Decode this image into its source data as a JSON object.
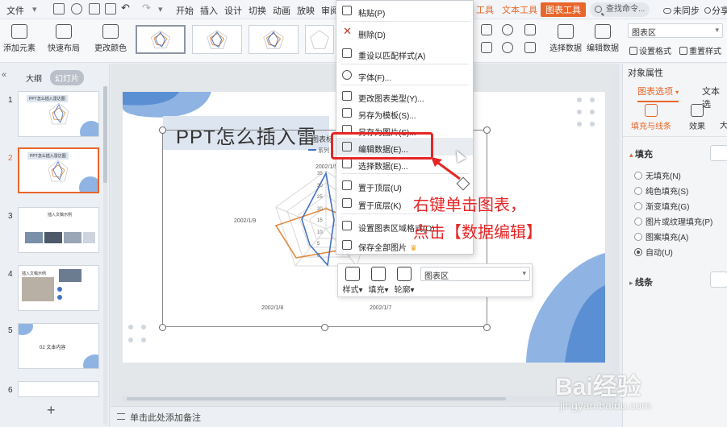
{
  "menubar": {
    "file": "文件",
    "tabs": [
      "开始",
      "插入",
      "设计",
      "切换",
      "动画",
      "放映",
      "审阅"
    ],
    "ctx_tabs": [
      "工具",
      "文本工具",
      "图表工具"
    ],
    "search": "查找命令...",
    "sync": "未同步",
    "share": "分享"
  },
  "ribbon": {
    "add_element": "添加元素",
    "quick_layout": "快速布局",
    "change_color": "更改颜色",
    "select_data": "选择数据",
    "edit_data": "编辑数据",
    "chart_area": "图表区",
    "set_format": "设置格式",
    "reset_style": "重置样式"
  },
  "left_panel": {
    "tab_outline": "大纲",
    "tab_slides": "幻灯片",
    "slides": [
      "1",
      "2",
      "3",
      "4",
      "5",
      "6"
    ],
    "slide1_title": "PPT怎么插入雷达图",
    "slide3_title": "插入文稿示例",
    "slide4_title": "插入文稿示例",
    "slide5_text": "02 文本内容"
  },
  "slide": {
    "title": "PPT怎么插入雷",
    "chart_title": "图表标",
    "legend": "系列 1",
    "axis_labels": [
      "2002/1/5",
      "2002/1/9",
      "2002/1/8",
      "2002/1/7"
    ],
    "ticks": [
      "35",
      "30",
      "25",
      "20",
      "15",
      "10",
      "5",
      "0"
    ]
  },
  "notes": "单击此处添加备注",
  "context_menu": {
    "items": [
      {
        "label": "粘贴(P)",
        "icon": "paste-icon"
      },
      {
        "label": "删除(D)",
        "icon": "delete-icon"
      },
      {
        "label": "重设以匹配样式(A)",
        "icon": "reset-style-icon"
      },
      {
        "label": "字体(F)...",
        "icon": "font-icon"
      },
      {
        "label": "更改图表类型(Y)...",
        "icon": "chart-type-icon"
      },
      {
        "label": "另存为模板(S)...",
        "icon": "save-template-icon"
      },
      {
        "label": "另存为图片(S)...",
        "icon": "save-image-icon"
      },
      {
        "label": "编辑数据(E)...",
        "icon": "edit-data-icon"
      },
      {
        "label": "选择数据(E)...",
        "icon": "select-data-icon"
      },
      {
        "label": "置于顶层(U)",
        "icon": "bring-front-icon"
      },
      {
        "label": "置于底层(K)",
        "icon": "send-back-icon"
      },
      {
        "label": "设置图表区域格式(O)...",
        "icon": "format-area-icon"
      },
      {
        "label": "保存全部图片",
        "icon": "save-all-images-icon"
      }
    ]
  },
  "mini_toolbar": {
    "style": "样式",
    "fill": "填充",
    "outline": "轮廓",
    "select_value": "图表区"
  },
  "right_panel": {
    "title": "对象属性",
    "tab_chart_options": "图表选项",
    "tab_text_options": "文本选",
    "sub_fill_line": "填充与线条",
    "sub_effects": "效果",
    "sub_size": "大",
    "section_fill": "填充",
    "fill_options": [
      "无填充(N)",
      "纯色填充(S)",
      "渐变填充(G)",
      "图片或纹理填充(P)",
      "图案填充(A)",
      "自动(U)"
    ],
    "selected_fill": "自动(U)",
    "section_line": "线条"
  },
  "annotation": {
    "line1": "右键单击图表，",
    "line2": "点击【数据编辑】"
  },
  "watermark": {
    "logo": "Bai经验",
    "url": "jingyan.baidu.com"
  },
  "colors": {
    "accent": "#e8662a",
    "annotation_red": "#e62626",
    "radar_blue": "#4472c4",
    "radar_orange": "#e08a3c",
    "slide_blue": "#8fb4e3"
  }
}
